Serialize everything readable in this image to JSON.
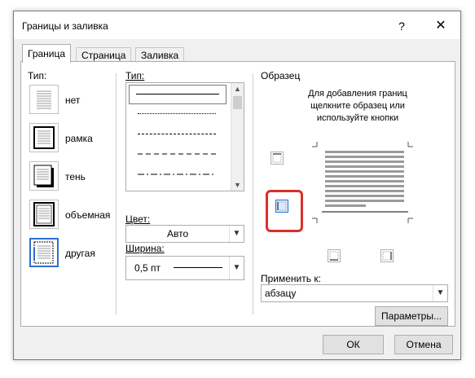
{
  "window": {
    "title": "Границы и заливка",
    "help_label": "?",
    "close_label": "✕"
  },
  "tabs": [
    {
      "label": "Граница",
      "active": true
    },
    {
      "label": "Страница",
      "active": false
    },
    {
      "label": "Заливка",
      "active": false
    }
  ],
  "setting": {
    "label": "Тип:",
    "items": [
      {
        "label": "нет",
        "icon": "border-none-icon"
      },
      {
        "label": "рамка",
        "icon": "border-box-icon"
      },
      {
        "label": "тень",
        "icon": "border-shadow-icon"
      },
      {
        "label": "объемная",
        "icon": "border-3d-icon"
      },
      {
        "label": "другая",
        "icon": "border-custom-icon",
        "selected": true
      }
    ]
  },
  "style": {
    "label": "Тип:",
    "lines": [
      "solid",
      "dotted",
      "dashed-small",
      "dashed",
      "dash-dot"
    ],
    "selected_index": 0
  },
  "color": {
    "label": "Цвет:",
    "value": "Авто"
  },
  "width": {
    "label": "Ширина:",
    "value": "0,5 пт"
  },
  "preview": {
    "label": "Образец",
    "instructions": [
      "Для добавления границ",
      "щелкните образец или",
      "используйте кнопки"
    ]
  },
  "apply_to": {
    "label": "Применить к:",
    "value": "абзацу"
  },
  "options_button": "Параметры...",
  "footer": {
    "ok": "ОК",
    "cancel": "Отмена"
  },
  "colors": {
    "accent": "#2b6fd1",
    "highlight": "#d9302c"
  }
}
